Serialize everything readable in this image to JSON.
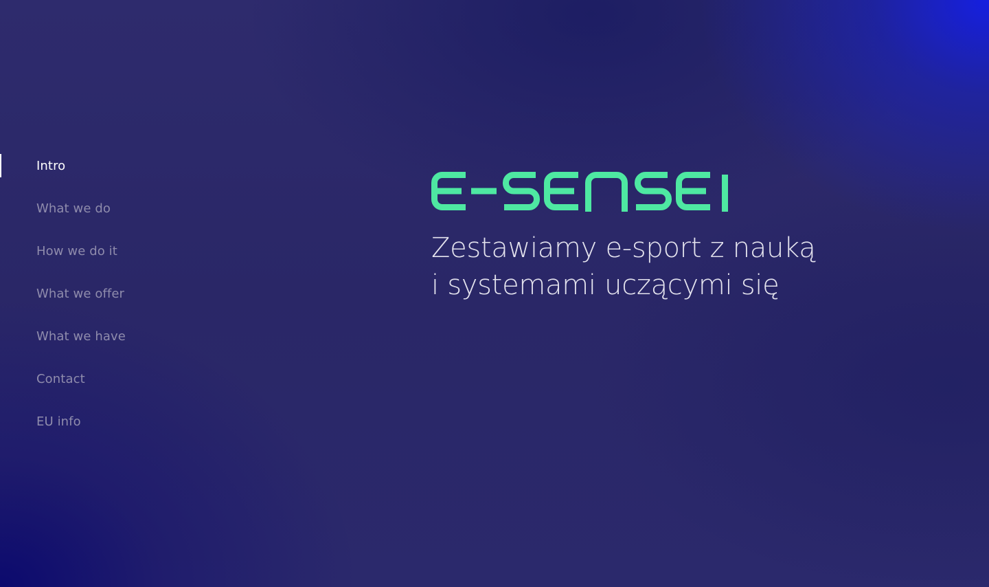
{
  "nav": {
    "items": [
      {
        "label": "Intro",
        "active": true
      },
      {
        "label": "What we do",
        "active": false
      },
      {
        "label": "How we do it",
        "active": false
      },
      {
        "label": "What we offer",
        "active": false
      },
      {
        "label": "What we have",
        "active": false
      },
      {
        "label": "Contact",
        "active": false
      },
      {
        "label": "EU info",
        "active": false
      }
    ]
  },
  "hero": {
    "logo_text": "E-SENSEI",
    "tagline_line1": "Zestawiamy e-sport z nauką",
    "tagline_line2": "i systemami uczącymi się"
  },
  "colors": {
    "accent": "#4ee8a2",
    "nav_active": "#ffffff",
    "nav_inactive": "#8f8cac",
    "background": "#2c2a6b",
    "background_corner": "#1020d8"
  }
}
